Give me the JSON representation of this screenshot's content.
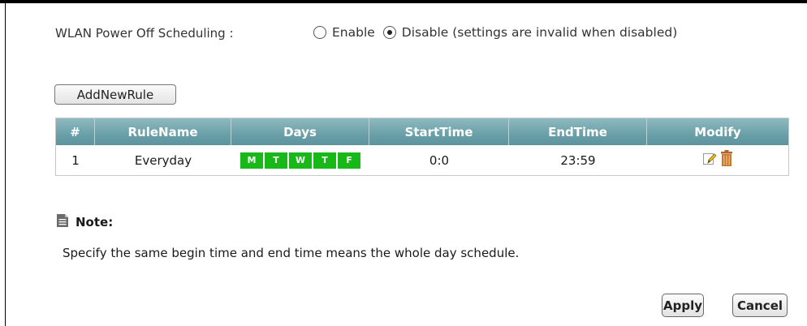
{
  "scheduling": {
    "label": "WLAN Power Off Scheduling :",
    "options": [
      {
        "label": "Enable",
        "selected": false
      },
      {
        "label": "Disable (settings are invalid when disabled)",
        "selected": true
      }
    ]
  },
  "add_rule_label": "AddNewRule",
  "table": {
    "headers": [
      "#",
      "RuleName",
      "Days",
      "StartTime",
      "EndTime",
      "Modify"
    ],
    "rows": [
      {
        "num": "1",
        "name": "Everyday",
        "days": [
          "M",
          "T",
          "W",
          "T",
          "F"
        ],
        "start": "0:0",
        "end": "23:59"
      }
    ],
    "header_color": "#6aa0a8",
    "day_color": "#18b818"
  },
  "note": {
    "title": "Note:",
    "text": "Specify the same begin time and end time means the whole day schedule."
  },
  "buttons": {
    "apply": "Apply",
    "cancel": "Cancel"
  },
  "icons": {
    "edit": "pencil-edit-icon",
    "delete": "trash-icon",
    "note": "document-note-icon"
  }
}
